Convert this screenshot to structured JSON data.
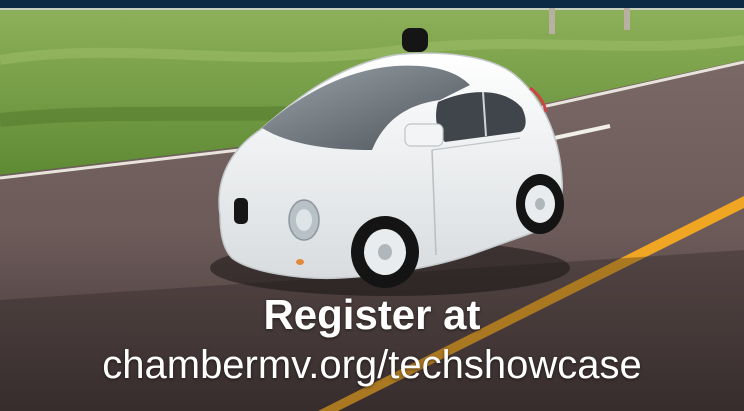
{
  "banner": {
    "line1": "Register at",
    "line2": "chambermv.org/techshowcase"
  },
  "colors": {
    "top_strip": "#0c2a44",
    "grass": "#6f9a3c",
    "road": "#6b5a58",
    "road_line": "#f0a623",
    "car_body": "#eef0f2",
    "text": "#ffffff"
  }
}
